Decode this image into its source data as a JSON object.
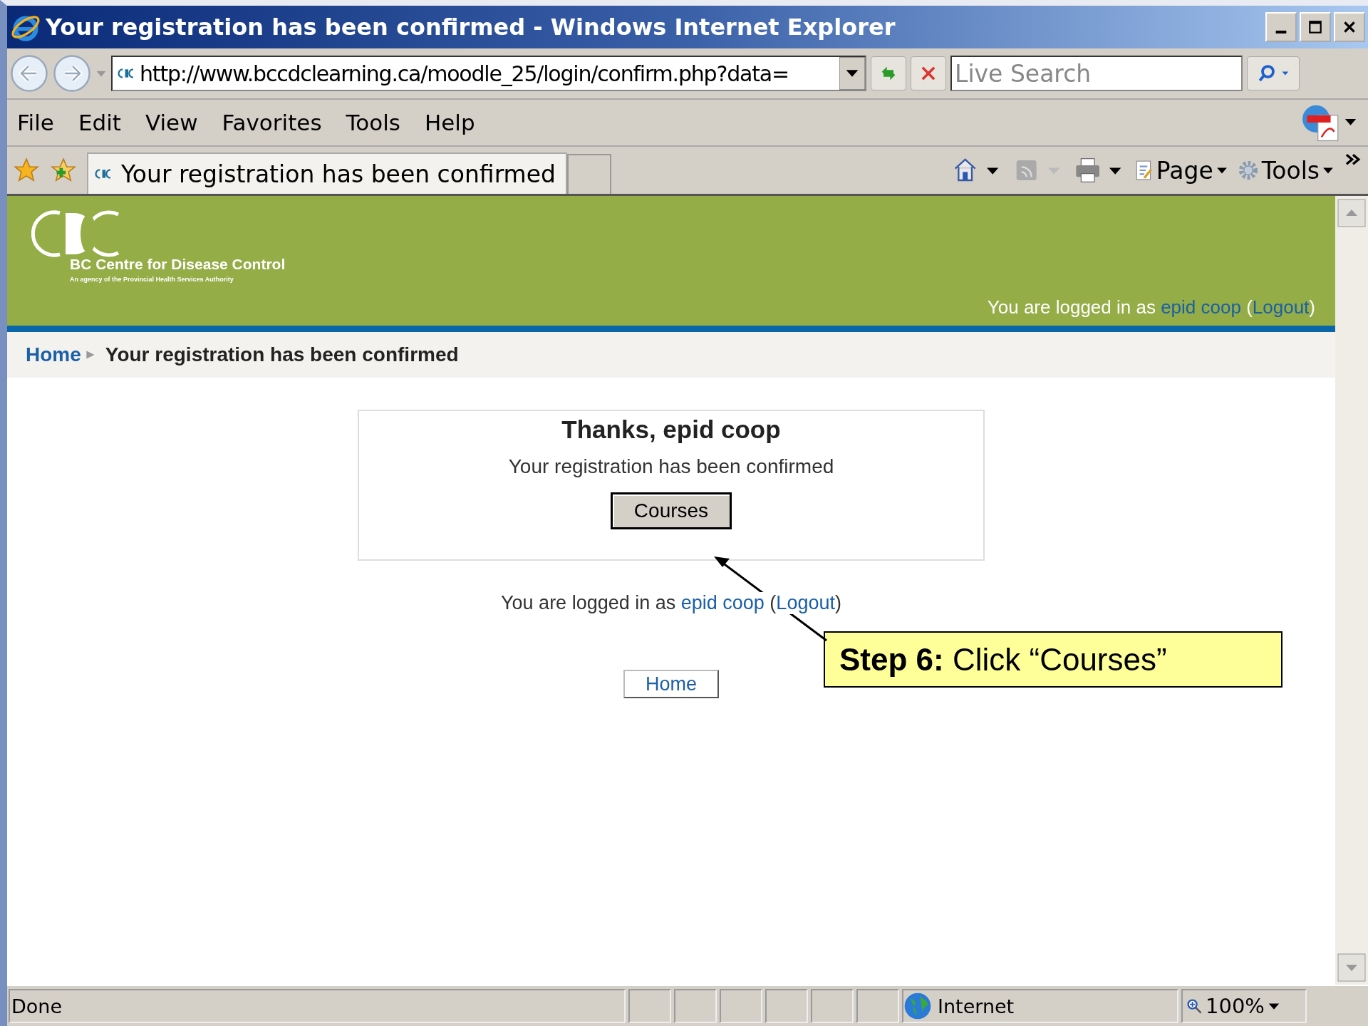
{
  "window": {
    "title": "Your registration has been confirmed - Windows Internet Explorer"
  },
  "address_bar": {
    "url": "http://www.bccdclearning.ca/moodle_25/login/confirm.php?data="
  },
  "search": {
    "placeholder": "Live Search"
  },
  "menu": [
    "File",
    "Edit",
    "View",
    "Favorites",
    "Tools",
    "Help"
  ],
  "tabs": [
    {
      "label": "Your registration has been confirmed",
      "selected": true
    }
  ],
  "command_bar": [
    "Page",
    "Tools"
  ],
  "header": {
    "logo_name": "BC Centre for Disease Control",
    "logo_tagline": "An agency of the Provincial Health Services Authority",
    "before": "You are logged in as",
    "user": "epid coop",
    "open": "(",
    "logout": "Logout",
    "close": ")"
  },
  "breadcrumb": {
    "home": "Home",
    "current": "Your registration has been confirmed"
  },
  "confirm_box": {
    "heading": "Thanks, epid coop",
    "message": "Your registration has been confirmed",
    "button": "Courses"
  },
  "footer_login": {
    "before": "You are logged in as",
    "user": "epid coop",
    "open": "(",
    "logout": "Logout",
    "close": ")"
  },
  "home_button": "Home",
  "callout": "**Step 6:** Click “Courses”",
  "status_bar": {
    "text": "Done",
    "zone": "Internet",
    "zoom": "100%"
  }
}
